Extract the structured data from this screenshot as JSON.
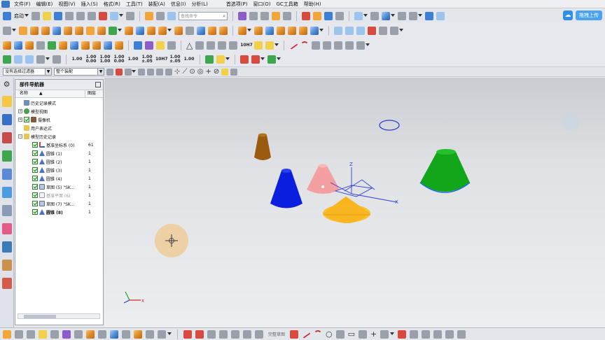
{
  "menubar": {
    "items": [
      "文件(F)",
      "编辑(E)",
      "视图(V)",
      "插入(S)",
      "格式(R)",
      "工具(T)",
      "装配(A)",
      "信息(I)",
      "分析(L)",
      "首选项(P)",
      "窗口(O)",
      "GC工具箱",
      "帮助(H)"
    ]
  },
  "toolbar": {
    "start_label": "启动",
    "search_placeholder": "查找命令",
    "cloud_label": "拖拽上传"
  },
  "dimension_buttons": [
    "1.00",
    "1.00\n0.00",
    "1.00\n1.00",
    "1.00\n0.00",
    "1.00",
    "1.00\n±.05",
    "10H7",
    "1.00\n±.05",
    "1.00"
  ],
  "selection_bar": {
    "filter_value": "没有选择过滤器",
    "scope_value": "整个装配"
  },
  "navigator": {
    "title": "部件导航器",
    "col_name": "名称",
    "col_layer": "图层",
    "rows": [
      {
        "label": "历史记录模式",
        "value": ""
      },
      {
        "label": "模型视图",
        "value": ""
      },
      {
        "label": "摄像机",
        "value": ""
      },
      {
        "label": "用户表达式",
        "value": ""
      },
      {
        "label": "模型历史记录",
        "value": ""
      },
      {
        "label": "基准坐标系 (0)",
        "value": "61"
      },
      {
        "label": "圆锥 (1)",
        "value": "1"
      },
      {
        "label": "圆锥 (2)",
        "value": "1"
      },
      {
        "label": "圆锥 (3)",
        "value": "1"
      },
      {
        "label": "圆锥 (4)",
        "value": "1"
      },
      {
        "label": "草图 (5) \"SK...",
        "value": "1"
      },
      {
        "label": "基准平面 (6)",
        "value": "1"
      },
      {
        "label": "草图 (7) \"SK...",
        "value": "1"
      },
      {
        "label": "圆锥 (8)",
        "value": "1"
      }
    ]
  },
  "bottom_bar": {
    "label": "完整草图"
  },
  "colors": {
    "cone_brown": "#9a5a10",
    "cone_blue": "#0a1ee0",
    "cone_pink": "#f4a0a0",
    "cone_orange": "#f7b51e",
    "cone_green": "#13a61a",
    "sketch_blue": "#2a3fd6"
  },
  "icons": [
    "search-icon",
    "cloud-icon",
    "cone-icon",
    "sketch-icon",
    "datum-csys-icon",
    "camera-icon",
    "folder-icon",
    "history-icon",
    "move-cursor-icon"
  ]
}
